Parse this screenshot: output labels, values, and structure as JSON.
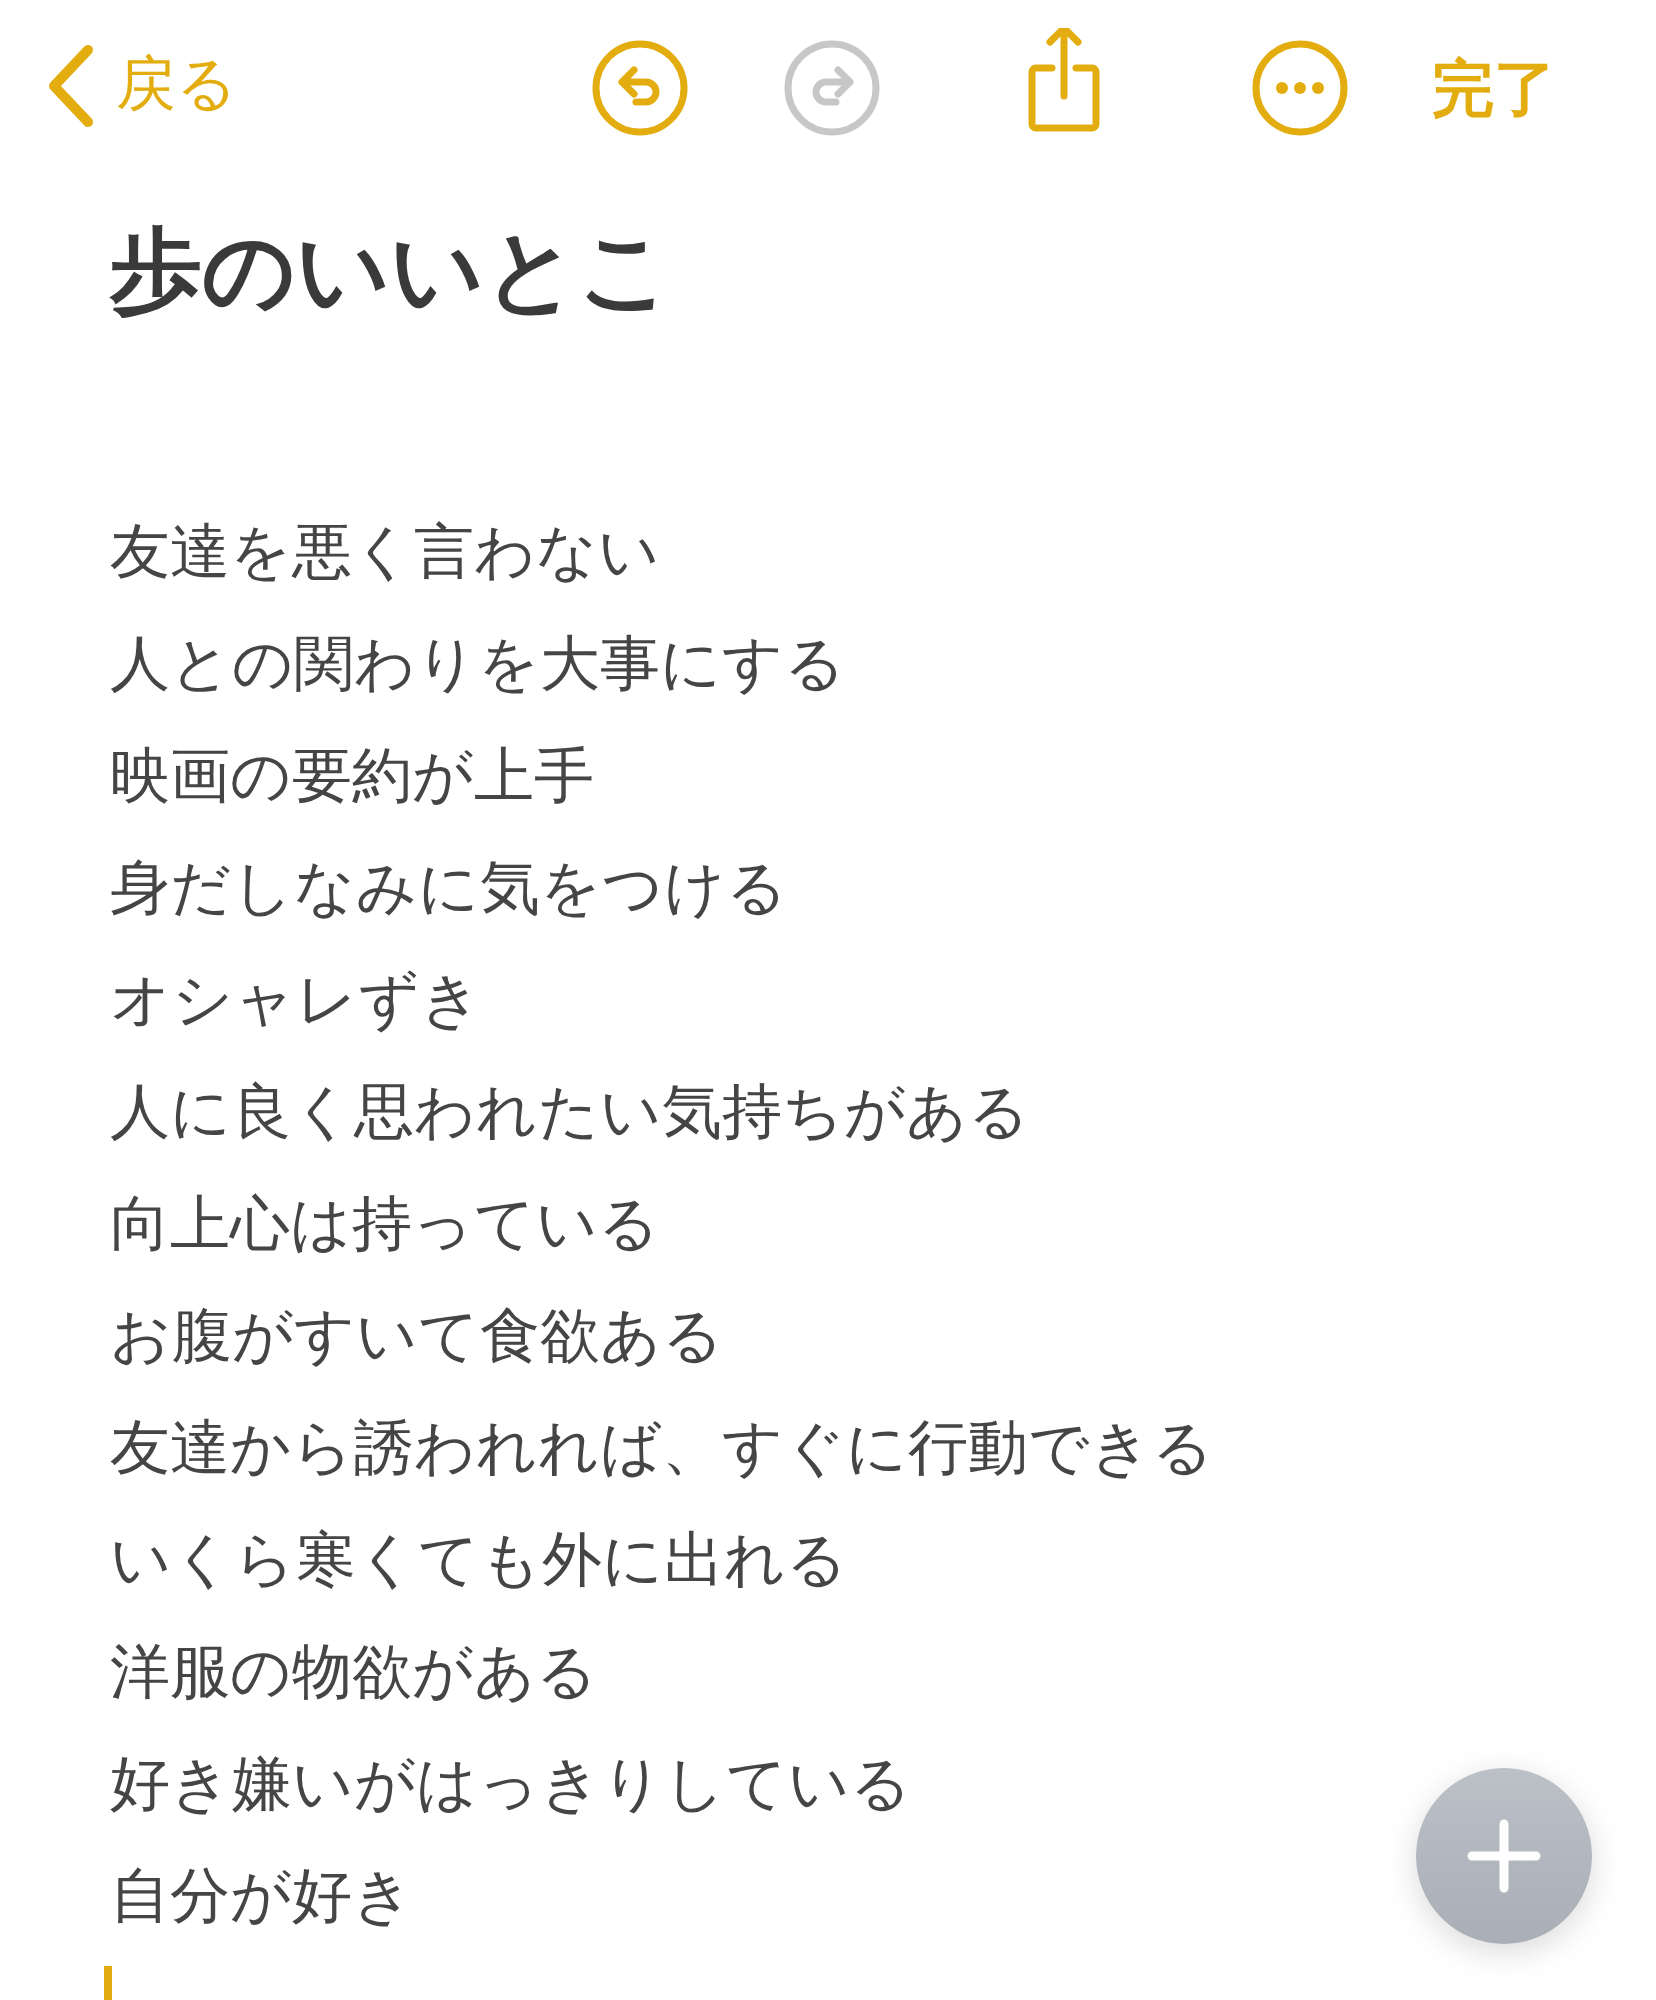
{
  "toolbar": {
    "back_label": "戻る",
    "done_label": "完了",
    "actions": [
      {
        "kind": "undo",
        "disabled": false
      },
      {
        "kind": "redo",
        "disabled": true
      },
      {
        "kind": "share",
        "disabled": false
      },
      {
        "kind": "more",
        "disabled": false
      }
    ]
  },
  "note": {
    "title": "歩のいいとこ",
    "lines": [
      "友達を悪く言わない",
      "人との関わりを大事にする",
      "映画の要約が上手",
      "身だしなみに気をつける",
      "オシャレずき",
      "人に良く思われたい気持ちがある",
      "向上心は持っている",
      "お腹がすいて食欲ある",
      "友達から誘われれば、すぐに行動できる",
      "いくら寒くても外に出れる",
      "洋服の物欲がある",
      "好き嫌いがはっきりしている",
      "自分が好き"
    ]
  }
}
